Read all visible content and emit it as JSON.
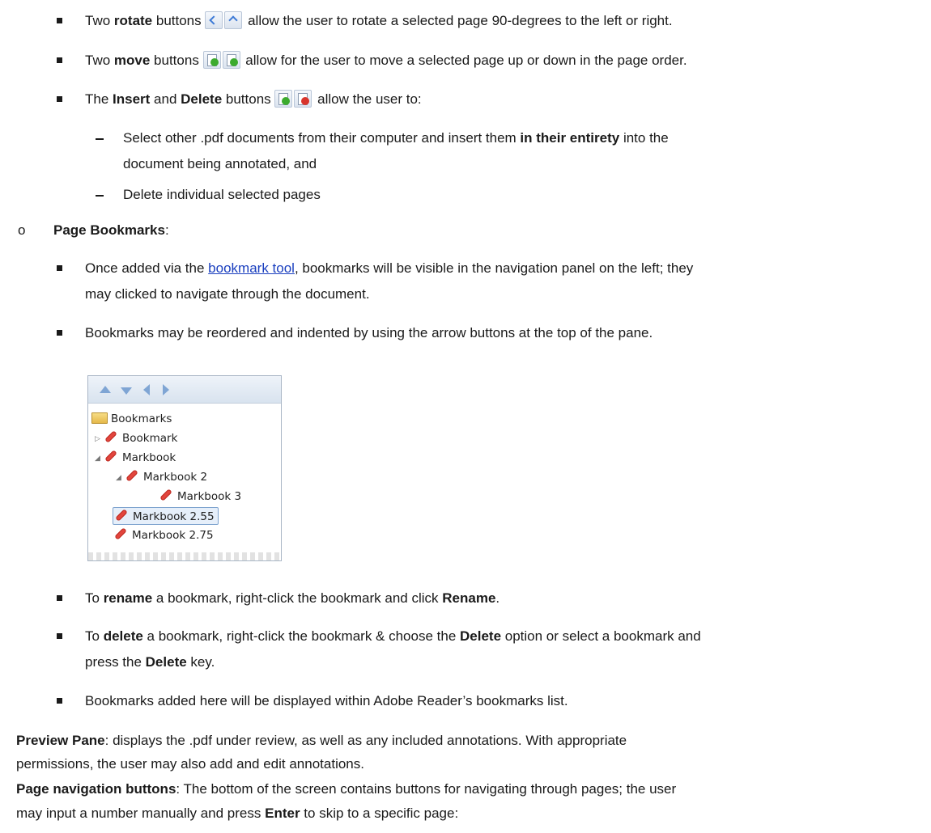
{
  "items": {
    "rotate": {
      "pre": "Two ",
      "bold": "rotate",
      "mid": " buttons",
      "post": " allow the user to rotate a selected page 90-degrees to the left or right."
    },
    "move": {
      "pre": "Two ",
      "bold": "move",
      "mid": " buttons",
      "post": " allow for the user to move a selected page up or down in the page order."
    },
    "insert": {
      "pre": "The  ",
      "b1": "Insert",
      "and": " and ",
      "b2": "Delete",
      "mid": " buttons",
      "post": " allow the user to:"
    },
    "sub1_l1_pre": "Select other .pdf documents from their computer and insert them ",
    "sub1_l1_bold": "in their entirety",
    "sub1_l1_post": " into the",
    "sub1_l2": "document being annotated, and",
    "sub2": "Delete individual selected pages"
  },
  "bookmarks_section": {
    "title": "Page Bookmarks",
    "colon": ":",
    "b1_l1_pre": "Once added via the ",
    "b1_link": "bookmark tool",
    "b1_l1_post": ", bookmarks will be visible in the navigation panel on the left; they",
    "b1_l2": "may clicked to navigate through the document.",
    "b2": "Bookmarks may be reordered and indented by using the arrow buttons at the top of the pane.",
    "tree": {
      "root": "Bookmarks",
      "n1": "Bookmark",
      "n2": "Markbook",
      "n3": "Markbook 2",
      "n4": "Markbook 3",
      "n5": "Markbook 2.55",
      "n6": "Markbook 2.75"
    },
    "rename": {
      "pre": "To ",
      "b1": "rename",
      "mid": " a bookmark, right-click the bookmark and click ",
      "b2": "Rename",
      "post": "."
    },
    "delete": {
      "pre": "To ",
      "b1": "delete",
      "mid": " a bookmark, right-click the bookmark & choose the ",
      "b2": "Delete",
      "post": " option or select a bookmark and",
      "l2_pre": "press the ",
      "l2_bold": "Delete",
      "l2_post": " key."
    },
    "adobe": "Bookmarks added here will be displayed within Adobe Reader’s bookmarks list."
  },
  "preview": {
    "bold": "Preview Pane",
    "l1": ": displays the .pdf under review, as well as any included annotations. With appropriate",
    "l2": "permissions, the user may also add and edit annotations."
  },
  "navbuttons": {
    "bold": "Page navigation buttons",
    "l1": ": The bottom of the screen contains buttons for navigating through pages; the user",
    "l2_pre": "may input a number manually and press ",
    "l2_bold": "Enter",
    "l2_post": " to skip to a specific page:"
  }
}
